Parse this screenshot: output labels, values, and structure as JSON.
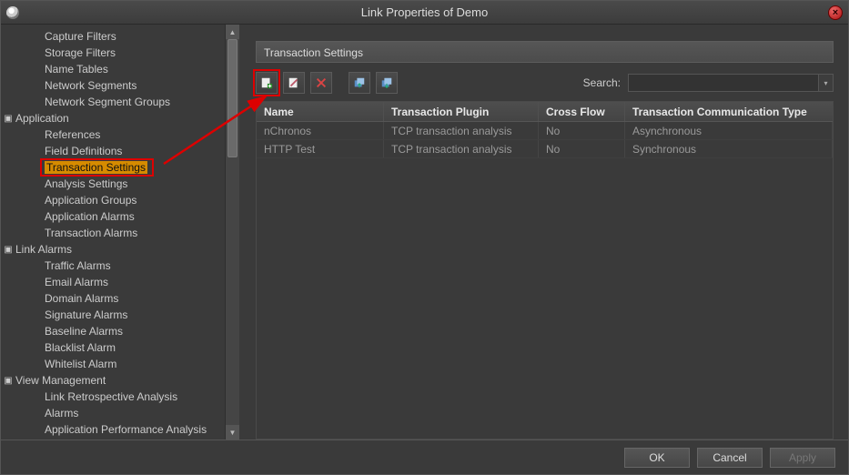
{
  "window": {
    "title": "Link Properties of Demo"
  },
  "sidebar": {
    "items": [
      {
        "label": "Capture Filters",
        "level": 1
      },
      {
        "label": "Storage Filters",
        "level": 1
      },
      {
        "label": "Name Tables",
        "level": 1
      },
      {
        "label": "Network Segments",
        "level": 1
      },
      {
        "label": "Network Segment Groups",
        "level": 1
      },
      {
        "label": "Application",
        "level": 0,
        "expandable": true
      },
      {
        "label": "References",
        "level": 1
      },
      {
        "label": "Field Definitions",
        "level": 1
      },
      {
        "label": "Transaction Settings",
        "level": 1,
        "selected": true
      },
      {
        "label": "Analysis Settings",
        "level": 1
      },
      {
        "label": "Application Groups",
        "level": 1
      },
      {
        "label": "Application Alarms",
        "level": 1
      },
      {
        "label": "Transaction Alarms",
        "level": 1
      },
      {
        "label": "Link Alarms",
        "level": 0,
        "expandable": true
      },
      {
        "label": "Traffic Alarms",
        "level": 1
      },
      {
        "label": "Email Alarms",
        "level": 1
      },
      {
        "label": "Domain Alarms",
        "level": 1
      },
      {
        "label": "Signature Alarms",
        "level": 1
      },
      {
        "label": "Baseline Alarms",
        "level": 1
      },
      {
        "label": "Blacklist Alarm",
        "level": 1
      },
      {
        "label": "Whitelist Alarm",
        "level": 1
      },
      {
        "label": "View Management",
        "level": 0,
        "expandable": true
      },
      {
        "label": "Link Retrospective Analysis",
        "level": 1
      },
      {
        "label": "Alarms",
        "level": 1
      },
      {
        "label": "Application Performance Analysis",
        "level": 1
      }
    ]
  },
  "main": {
    "section_title": "Transaction Settings",
    "search_label": "Search:",
    "search_value": "",
    "columns": {
      "name": "Name",
      "plugin": "Transaction Plugin",
      "cross": "Cross Flow",
      "comm": "Transaction Communication Type"
    },
    "rows": [
      {
        "name": "nChronos",
        "plugin": "TCP transaction analysis",
        "cross": "No",
        "comm": "Asynchronous"
      },
      {
        "name": "HTTP Test",
        "plugin": "TCP transaction analysis",
        "cross": "No",
        "comm": "Synchronous"
      }
    ]
  },
  "footer": {
    "ok": "OK",
    "cancel": "Cancel",
    "apply": "Apply"
  }
}
